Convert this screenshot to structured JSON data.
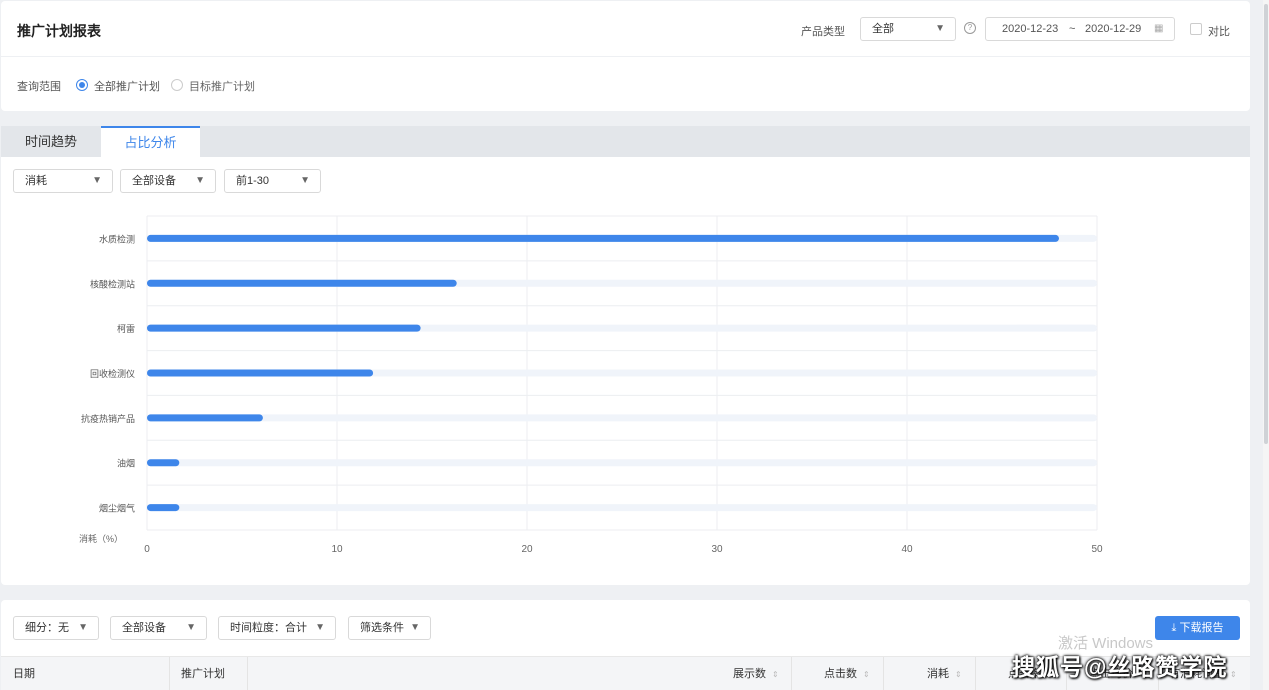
{
  "header": {
    "title": "推广计划报表",
    "product_type_label": "产品类型",
    "product_type_value": "全部",
    "date_start": "2020-12-23",
    "date_sep": "~",
    "date_end": "2020-12-29",
    "compare_label": "对比"
  },
  "scope": {
    "label": "查询范围",
    "options": [
      "全部推广计划",
      "目标推广计划"
    ],
    "selected": 0
  },
  "tabs": [
    "时间趋势",
    "占比分析"
  ],
  "active_tab": 1,
  "chart_filters": {
    "metric": "消耗",
    "device": "全部设备",
    "range": "前1-30"
  },
  "chart_data": {
    "type": "bar",
    "orientation": "horizontal",
    "categories": [
      "水质检测",
      "核酸检测站",
      "柯雷",
      "回收检测仪",
      "抗疫热销产品",
      "油烟",
      "烟尘烟气"
    ],
    "values": [
      48,
      16.3,
      14.4,
      11.9,
      6.1,
      1.7,
      1.7
    ],
    "ylabel": "消耗（%）",
    "xlim": [
      0,
      50
    ],
    "xticks": [
      0,
      10,
      20,
      30,
      40,
      50
    ],
    "grid": true,
    "bar_color": "#3e86ea",
    "track_color": "#f0f4fa"
  },
  "table_toolbar": {
    "breakdown": "细分：无",
    "device": "全部设备",
    "granularity": "时间粒度：合计",
    "filter": "筛选条件",
    "download": "下载报告"
  },
  "table": {
    "columns": [
      "日期",
      "推广计划",
      "展示数",
      "点击数",
      "消耗",
      "点击率",
      "点击均价",
      "有消耗词量"
    ]
  },
  "watermarks": {
    "windows": "激活 Windows",
    "site": "搜狐号@丝路赞学院"
  }
}
